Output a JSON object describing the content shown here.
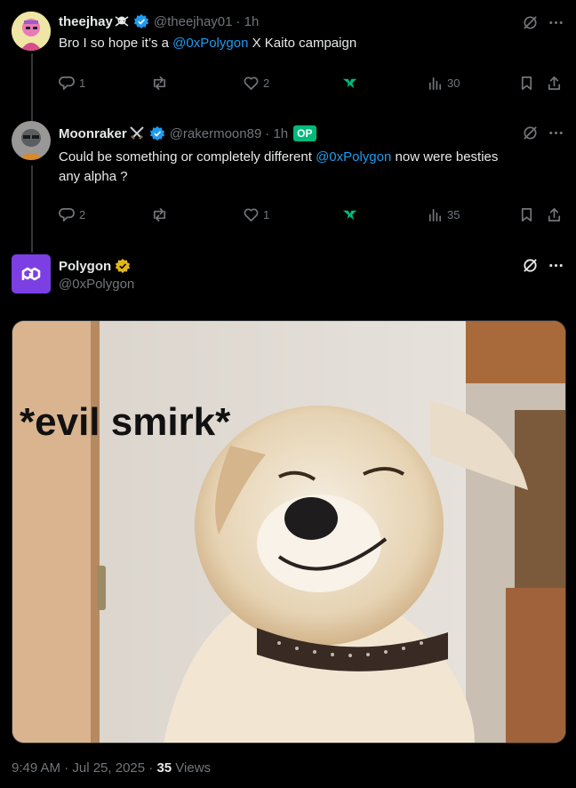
{
  "tweet1": {
    "name": "theejhay",
    "name_suffix_icon": "skull-crossbones-icon",
    "handle": "@theejhay01",
    "time": "· 1h",
    "text_prefix": "Bro I so hope it’s a ",
    "mention": "@0xPolygon",
    "text_suffix": " X Kaito campaign",
    "replies": "1",
    "likes": "2",
    "views": "30"
  },
  "tweet2": {
    "name": "Moonraker",
    "name_suffix_icon": "crossed-swords-icon",
    "handle": "@rakermoon89",
    "time": "· 1h",
    "op_badge": "OP",
    "text_prefix": "Could be something or completely different ",
    "mention": "@0xPolygon",
    "text_suffix": " now were besties",
    "text_line2": "any alpha ?",
    "replies": "2",
    "likes": "1",
    "views": "35"
  },
  "main_tweet": {
    "name": "Polygon",
    "handle": "@0xPolygon",
    "image_caption": "*evil smirk*",
    "timestamp": "9:49 AM · Jul 25, 2025 · ",
    "views_count": "35",
    "views_label": " Views"
  },
  "colors": {
    "accent": "#1d9bf0",
    "muted": "#71767b",
    "polygon_purple": "#7b3fe4",
    "op_green": "#00ba7c",
    "gold_badge": "#e2b719"
  }
}
